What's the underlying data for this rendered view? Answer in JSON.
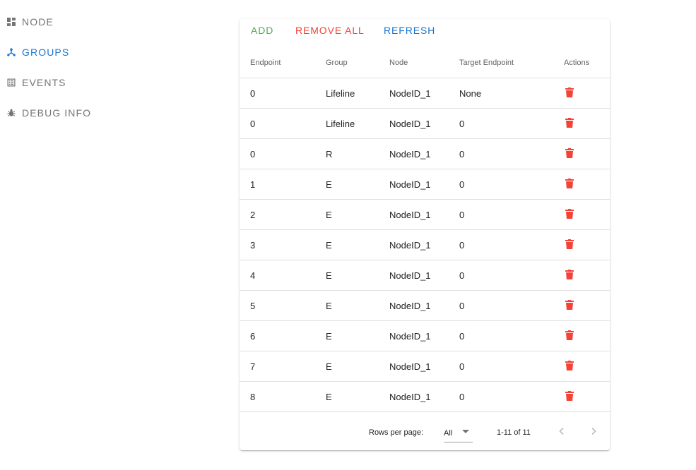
{
  "sidebar": {
    "items": [
      {
        "label": "NODE",
        "icon": "dashboard-icon",
        "active": false
      },
      {
        "label": "GROUPS",
        "icon": "device-hub-icon",
        "active": true
      },
      {
        "label": "EVENTS",
        "icon": "list-alt-icon",
        "active": false
      },
      {
        "label": "DEBUG INFO",
        "icon": "bug-icon",
        "active": false
      }
    ]
  },
  "toolbar": {
    "add_label": "ADD",
    "remove_all_label": "REMOVE ALL",
    "refresh_label": "REFRESH"
  },
  "colors": {
    "add": "#4caf50",
    "remove_all": "#f44336",
    "refresh": "#1976d2",
    "active_nav": "#1976d2",
    "delete_icon": "#f44336"
  },
  "table": {
    "columns": [
      "Endpoint",
      "Group",
      "Node",
      "Target Endpoint",
      "Actions"
    ],
    "rows": [
      [
        "0",
        "Lifeline",
        "NodeID_1",
        "None"
      ],
      [
        "0",
        "Lifeline",
        "NodeID_1",
        "0"
      ],
      [
        "0",
        "R",
        "NodeID_1",
        "0"
      ],
      [
        "1",
        "E",
        "NodeID_1",
        "0"
      ],
      [
        "2",
        "E",
        "NodeID_1",
        "0"
      ],
      [
        "3",
        "E",
        "NodeID_1",
        "0"
      ],
      [
        "4",
        "E",
        "NodeID_1",
        "0"
      ],
      [
        "5",
        "E",
        "NodeID_1",
        "0"
      ],
      [
        "6",
        "E",
        "NodeID_1",
        "0"
      ],
      [
        "7",
        "E",
        "NodeID_1",
        "0"
      ],
      [
        "8",
        "E",
        "NodeID_1",
        "0"
      ]
    ],
    "action_icon": "delete-icon"
  },
  "pagination": {
    "rows_per_page_label": "Rows per page:",
    "rows_per_page_value": "All",
    "range_text": "1-11 of 11"
  }
}
